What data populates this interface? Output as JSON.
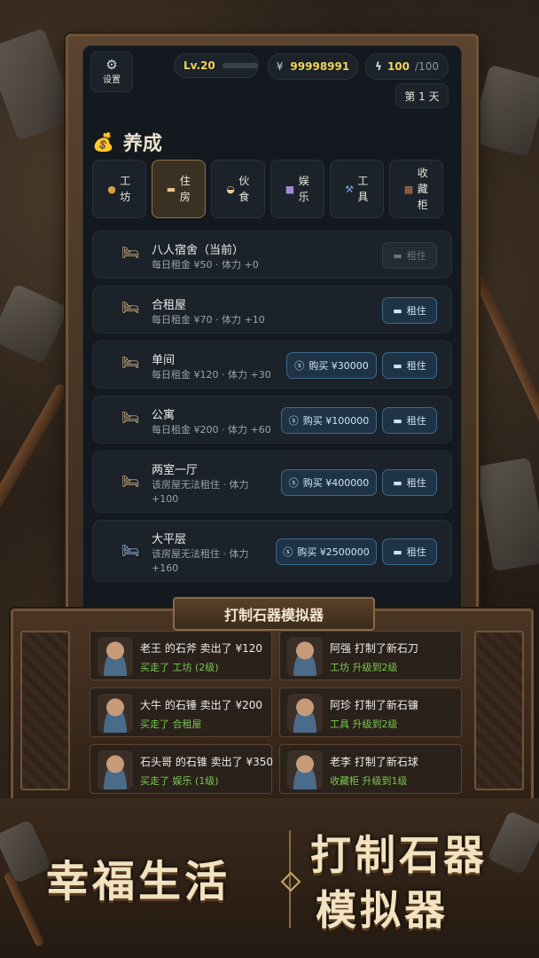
{
  "topbar": {
    "settings_label": "设置",
    "level": "Lv.20",
    "level_progress": 0.0,
    "money_symbol": "¥",
    "money": "99998991",
    "energy_icon": "lightning-icon",
    "energy": "100",
    "energy_max": "/100",
    "day": "第 1 天"
  },
  "section": {
    "icon": "money-bag-icon",
    "title": "养成"
  },
  "tabs": [
    {
      "icon": "workshop-icon",
      "label": "工坊",
      "active": false
    },
    {
      "icon": "bed-icon",
      "label": "住房",
      "active": true
    },
    {
      "icon": "food-icon",
      "label": "伙食",
      "active": false
    },
    {
      "icon": "entertainment-icon",
      "label": "娱乐",
      "active": false
    },
    {
      "icon": "tool-icon",
      "label": "工具",
      "active": false
    },
    {
      "icon": "cabinet-icon",
      "label": "收藏柜",
      "active": false
    }
  ],
  "housing": [
    {
      "name": "八人宿舍（当前）",
      "desc": "每日租金 ¥50 · 体力 +0",
      "buy": "",
      "rent": "租住",
      "rent_disabled": true
    },
    {
      "name": "合租屋",
      "desc": "每日租金 ¥70 · 体力 +10",
      "buy": "",
      "rent": "租住",
      "rent_disabled": false
    },
    {
      "name": "单间",
      "desc": "每日租金 ¥120 · 体力 +30",
      "buy": "购买 ¥30000",
      "rent": "租住",
      "rent_disabled": false
    },
    {
      "name": "公寓",
      "desc": "每日租金 ¥200 · 体力 +60",
      "buy": "购买 ¥100000",
      "rent": "租住",
      "rent_disabled": false
    },
    {
      "name": "两室一厅",
      "desc": "该房屋无法租住 · 体力 +100",
      "buy": "购买 ¥400000",
      "rent": "租住",
      "rent_disabled": false
    },
    {
      "name": "大平层",
      "desc": "该房屋无法租住 · 体力 +160",
      "buy": "购买 ¥2500000",
      "rent": "租住",
      "rent_disabled": false
    }
  ],
  "board": {
    "title": "打制石器模拟器",
    "news": [
      {
        "line1": "老王  的石斧  卖出了 ¥120",
        "line2": "买走了 工坊 (2级)"
      },
      {
        "line1": "阿强  打制了新石刀",
        "line2": "工坊 升级到2级"
      },
      {
        "line1": "大牛  的石锤  卖出了 ¥200",
        "line2": "买走了 合租屋"
      },
      {
        "line1": "阿珍  打制了新石镰",
        "line2": "工具 升级到2级"
      },
      {
        "line1": "石头哥  的石锥 卖出了 ¥350",
        "line2": "买走了 娱乐 (1级)"
      },
      {
        "line1": "老李  打制了新石球",
        "line2": "收藏柜 升级到1级"
      }
    ]
  },
  "banner": {
    "left": "幸福生活",
    "right_top": "打制石器",
    "right_bottom": "模拟器"
  }
}
